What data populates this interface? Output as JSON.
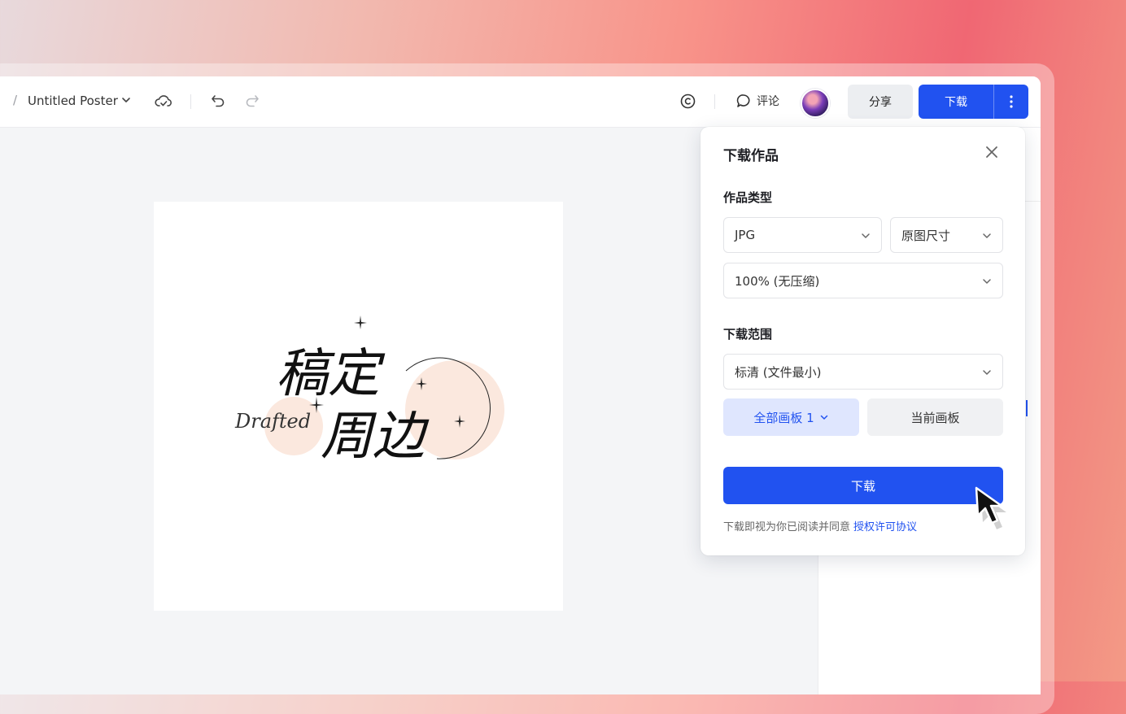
{
  "topbar": {
    "breadcrumb_sep": "/",
    "doc_title": "Untitled Poster",
    "comment_label": "评论",
    "share_label": "分享",
    "download_label": "下载"
  },
  "canvas": {
    "headline_line1": "稿定",
    "headline_line2": "周边",
    "script_word": "Drafted"
  },
  "download_panel": {
    "title": "下载作品",
    "type_section": "作品类型",
    "format_value": "JPG",
    "size_value": "原图尺寸",
    "quality_value": "100% (无压缩)",
    "range_section": "下载范围",
    "resolution_value": "标清 (文件最小)",
    "all_boards_label": "全部画板 1",
    "current_board_label": "当前画板",
    "download_button": "下载",
    "agree_text": "下载即视为你已阅读并同意",
    "agree_link": "授权许可协议"
  },
  "colors": {
    "accent": "#2152f0",
    "accent_light": "#dfe6fe",
    "peach": "#fbe8de"
  }
}
